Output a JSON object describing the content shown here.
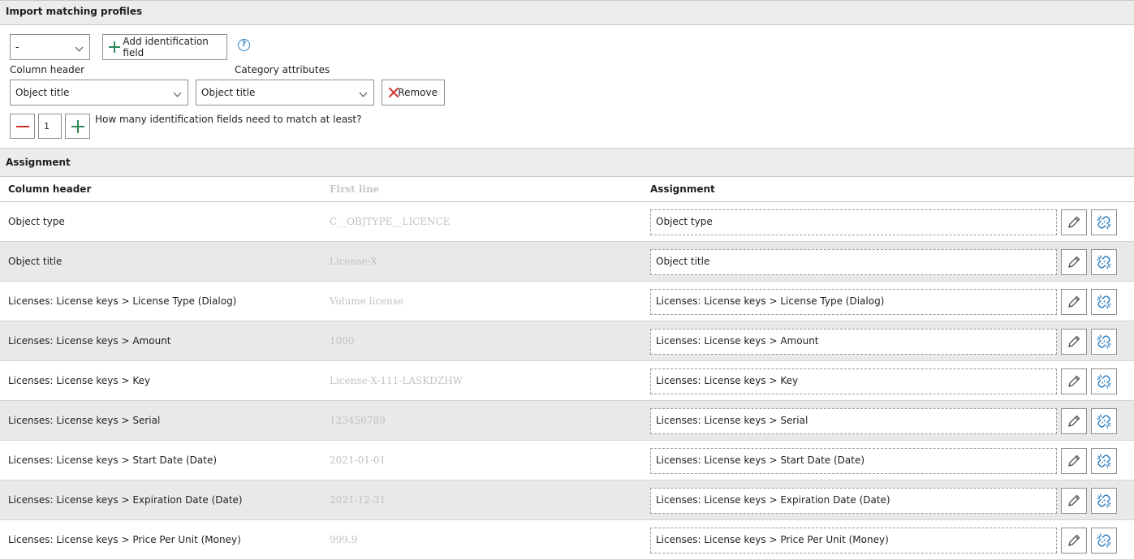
{
  "profiles": {
    "title": "Import matching profiles",
    "profile_select": "-",
    "add_field_label": "Add identification field",
    "help_glyph": "?",
    "column_header_label": "Column header",
    "category_attributes_label": "Category attributes",
    "column_header_value": "Object title",
    "category_attribute_value": "Object title",
    "remove_label": "Remove",
    "min_match_value": "1",
    "min_match_label": "How many identification fields need to match at least?"
  },
  "assignment": {
    "title": "Assignment",
    "columns": [
      "Column header",
      "First line",
      "Assignment"
    ],
    "rows": [
      {
        "header": "Object type",
        "first_line": "C__OBJTYPE__LICENCE",
        "assignment": "Object type"
      },
      {
        "header": "Object title",
        "first_line": "License-X",
        "assignment": "Object title"
      },
      {
        "header": "Licenses: License keys > License Type (Dialog)",
        "first_line": "Volume license",
        "assignment": "Licenses: License keys > License Type (Dialog)"
      },
      {
        "header": "Licenses: License keys > Amount",
        "first_line": "1000",
        "assignment": "Licenses: License keys > Amount"
      },
      {
        "header": "Licenses: License keys > Key",
        "first_line": "License-X-111-LASKDZHW",
        "assignment": "Licenses: License keys > Key"
      },
      {
        "header": "Licenses: License keys > Serial",
        "first_line": "123456789",
        "assignment": "Licenses: License keys > Serial"
      },
      {
        "header": "Licenses: License keys > Start Date (Date)",
        "first_line": "2021-01-01",
        "assignment": "Licenses: License keys > Start Date (Date)"
      },
      {
        "header": "Licenses: License keys > Expiration Date (Date)",
        "first_line": "2021-12-31",
        "assignment": "Licenses: License keys > Expiration Date (Date)"
      },
      {
        "header": "Licenses: License keys > Price Per Unit (Money)",
        "first_line": "999.9",
        "assignment": "Licenses: License keys > Price Per Unit (Money)"
      }
    ]
  },
  "colors": {
    "header_bg": "#ececec",
    "alt_row_bg": "#e9e9e9",
    "add_green": "#2e8b57",
    "remove_red": "#d0302b",
    "link_blue": "#2e7fc0",
    "first_line_text": "#c2c2c2"
  },
  "icons": {
    "add": "plus-icon",
    "remove": "close-icon",
    "help": "help-icon",
    "edit": "pencil-icon",
    "unlink": "unlink-icon",
    "dropdown": "chevron-down-icon"
  }
}
